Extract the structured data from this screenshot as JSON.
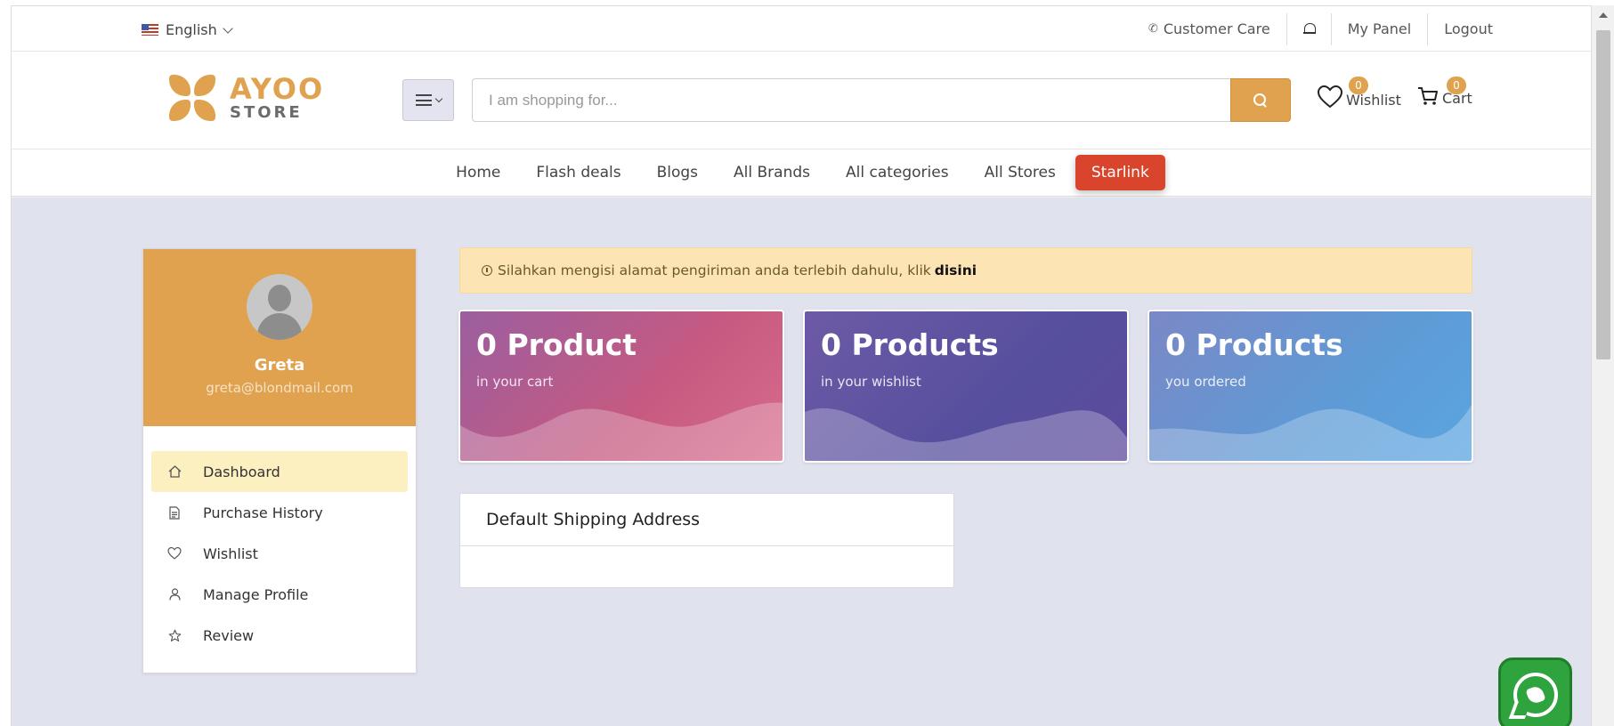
{
  "topbar": {
    "language": "English",
    "customer_care": "Customer Care",
    "my_panel": "My Panel",
    "logout": "Logout"
  },
  "header": {
    "logo_top": "AYOO",
    "logo_bottom": "STORE",
    "search_placeholder": "I am shopping for...",
    "wishlist_label": "Wishlist",
    "wishlist_count": "0",
    "cart_label": "Cart",
    "cart_count": "0"
  },
  "nav": {
    "items": [
      "Home",
      "Flash deals",
      "Blogs",
      "All Brands",
      "All categories",
      "All Stores"
    ],
    "highlight": "Starlink"
  },
  "profile": {
    "name": "Greta",
    "email": "greta@blondmail.com",
    "menu": [
      {
        "label": "Dashboard",
        "icon": "home-icon"
      },
      {
        "label": "Purchase History",
        "icon": "document-icon"
      },
      {
        "label": "Wishlist",
        "icon": "heart-icon"
      },
      {
        "label": "Manage Profile",
        "icon": "user-icon"
      },
      {
        "label": "Review",
        "icon": "star-icon"
      }
    ]
  },
  "alert": {
    "text": "Silahkan mengisi alamat pengiriman anda terlebih dahulu, klik",
    "link": "disini"
  },
  "stats": [
    {
      "value": "0 Product",
      "caption": "in your cart"
    },
    {
      "value": "0 Products",
      "caption": "in your wishlist"
    },
    {
      "value": "0 Products",
      "caption": "you ordered"
    }
  ],
  "shipping": {
    "title": "Default Shipping Address"
  },
  "colors": {
    "brand": "#e0a24f",
    "starlink": "#d9442c",
    "whatsapp": "#2fa33e"
  }
}
